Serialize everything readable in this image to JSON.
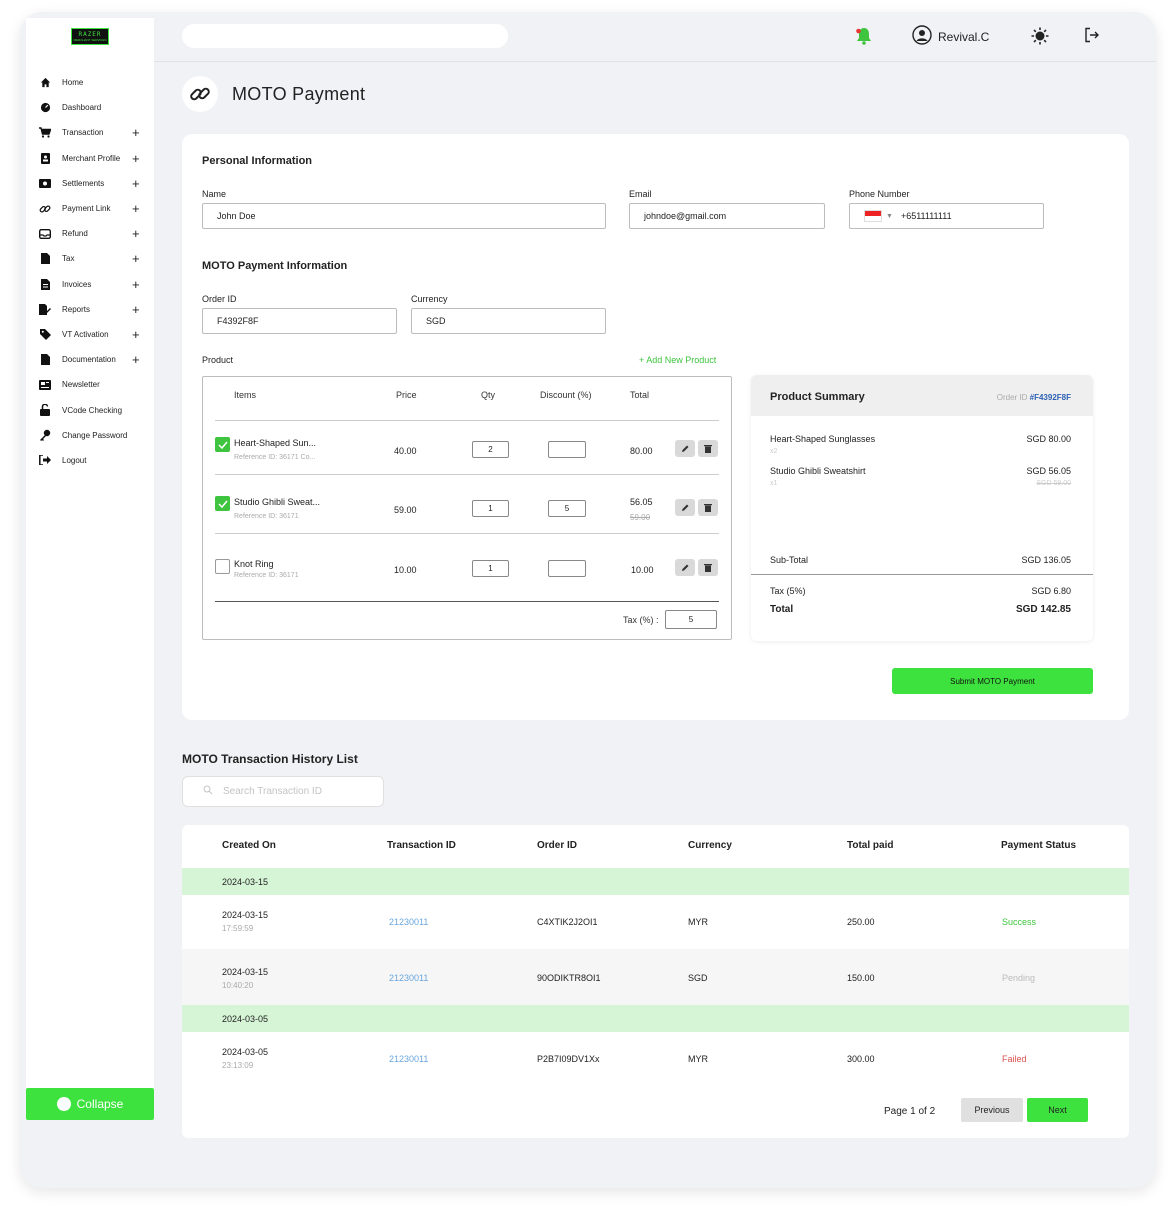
{
  "brand": {
    "logo_line1": "RAZER",
    "logo_line2": "MERCHANT SERVICES",
    "accent_color": "#3ee23e"
  },
  "sidebar": {
    "items": [
      {
        "label": "Home",
        "icon": "home-icon",
        "expandable": false
      },
      {
        "label": "Dashboard",
        "icon": "dashboard-icon",
        "expandable": false
      },
      {
        "label": "Transaction",
        "icon": "cart-icon",
        "expandable": true
      },
      {
        "label": "Merchant Profile",
        "icon": "profile-icon",
        "expandable": true
      },
      {
        "label": "Settlements",
        "icon": "money-icon",
        "expandable": true
      },
      {
        "label": "Payment Link",
        "icon": "link-icon",
        "expandable": true
      },
      {
        "label": "Refund",
        "icon": "inbox-icon",
        "expandable": true
      },
      {
        "label": "Tax",
        "icon": "file-icon",
        "expandable": true
      },
      {
        "label": "Invoices",
        "icon": "invoice-icon",
        "expandable": true
      },
      {
        "label": "Reports",
        "icon": "report-icon",
        "expandable": true
      },
      {
        "label": "VT Activation",
        "icon": "tag-icon",
        "expandable": true
      },
      {
        "label": "Documentation",
        "icon": "document-icon",
        "expandable": true
      },
      {
        "label": "Newsletter",
        "icon": "newspaper-icon",
        "expandable": false
      },
      {
        "label": "VCode Checking",
        "icon": "unlock-icon",
        "expandable": false
      },
      {
        "label": "Change Password",
        "icon": "key-icon",
        "expandable": false
      },
      {
        "label": "Logout",
        "icon": "logout-icon",
        "expandable": false
      }
    ],
    "plus": "+",
    "collapse_label": "Collapse"
  },
  "topbar": {
    "search_value": "",
    "user_name": "Revival.C"
  },
  "page": {
    "title": "MOTO Payment"
  },
  "personal": {
    "title": "Personal Information",
    "name_label": "Name",
    "name_value": "John Doe",
    "email_label": "Email",
    "email_value": "johndoe@gmail.com",
    "phone_label": "Phone Number",
    "phone_value": "+6511111111"
  },
  "moto": {
    "title": "MOTO Payment Information",
    "order_label": "Order ID",
    "order_value": "F4392F8F",
    "currency_label": "Currency",
    "currency_value": "SGD",
    "product_label": "Product",
    "add_product": "+ Add New Product"
  },
  "products": {
    "headers": {
      "items": "Items",
      "price": "Price",
      "qty": "Qty",
      "discount": "Discount (%)",
      "total": "Total"
    },
    "rows": [
      {
        "name": "Heart-Shaped Sun...",
        "ref": "Reference ID: 36171 Co...",
        "price": "40.00",
        "qty": "2",
        "discount": "",
        "total": "80.00",
        "old_total": "",
        "checked": true
      },
      {
        "name": "Studio Ghibli Sweat...",
        "ref": "Reference ID: 36171",
        "price": "59.00",
        "qty": "1",
        "discount": "5",
        "total": "56.05",
        "old_total": "59.00",
        "checked": true
      },
      {
        "name": "Knot Ring",
        "ref": "Reference ID: 36171",
        "price": "10.00",
        "qty": "1",
        "discount": "",
        "total": "10.00",
        "old_total": "",
        "checked": false
      }
    ],
    "tax_label": "Tax (%) :",
    "tax_value": "5"
  },
  "summary": {
    "title": "Product Summary",
    "order_prefix": "Order ID",
    "order_id": "#F4392F8F",
    "items": [
      {
        "name": "Heart-Shaped Sunglasses",
        "qty": "x2",
        "price": "SGD 80.00",
        "old_price": ""
      },
      {
        "name": "Studio Ghibli Sweatshirt",
        "qty": "x1",
        "price": "SGD 56.05",
        "old_price": "SGD 59.00"
      }
    ],
    "subtotal_label": "Sub-Total",
    "subtotal_value": "SGD 136.05",
    "tax_label": "Tax (5%)",
    "tax_value": "SGD 6.80",
    "total_label": "Total",
    "total_value": "SGD 142.85"
  },
  "submit_label": "Submit MOTO Payment",
  "history": {
    "title": "MOTO Transaction History List",
    "search_placeholder": "Search Transaction ID",
    "headers": {
      "created": "Created On",
      "txn": "Transaction ID",
      "order": "Order ID",
      "currency": "Currency",
      "total": "Total paid",
      "status": "Payment Status"
    },
    "groups": [
      {
        "date": "2024-03-15"
      },
      {
        "date": "2024-03-05"
      }
    ],
    "rows": [
      {
        "date": "2024-03-15",
        "time": "17:59:59",
        "txn": "21230011",
        "order": "C4XTIK2J2OI1",
        "currency": "MYR",
        "total": "250.00",
        "status": "Success",
        "status_color": "#3ec43e"
      },
      {
        "date": "2024-03-15",
        "time": "10:40:20",
        "txn": "21230011",
        "order": "90ODIKTR8OI1",
        "currency": "SGD",
        "total": "150.00",
        "status": "Pending",
        "status_color": "#bbbbbb"
      },
      {
        "date": "2024-03-05",
        "time": "23:13:09",
        "txn": "21230011",
        "order": "P2B7I09DV1Xx",
        "currency": "MYR",
        "total": "300.00",
        "status": "Failed",
        "status_color": "#d9534f"
      }
    ],
    "page_info": "Page 1 of 2",
    "prev_label": "Previous",
    "next_label": "Next"
  }
}
